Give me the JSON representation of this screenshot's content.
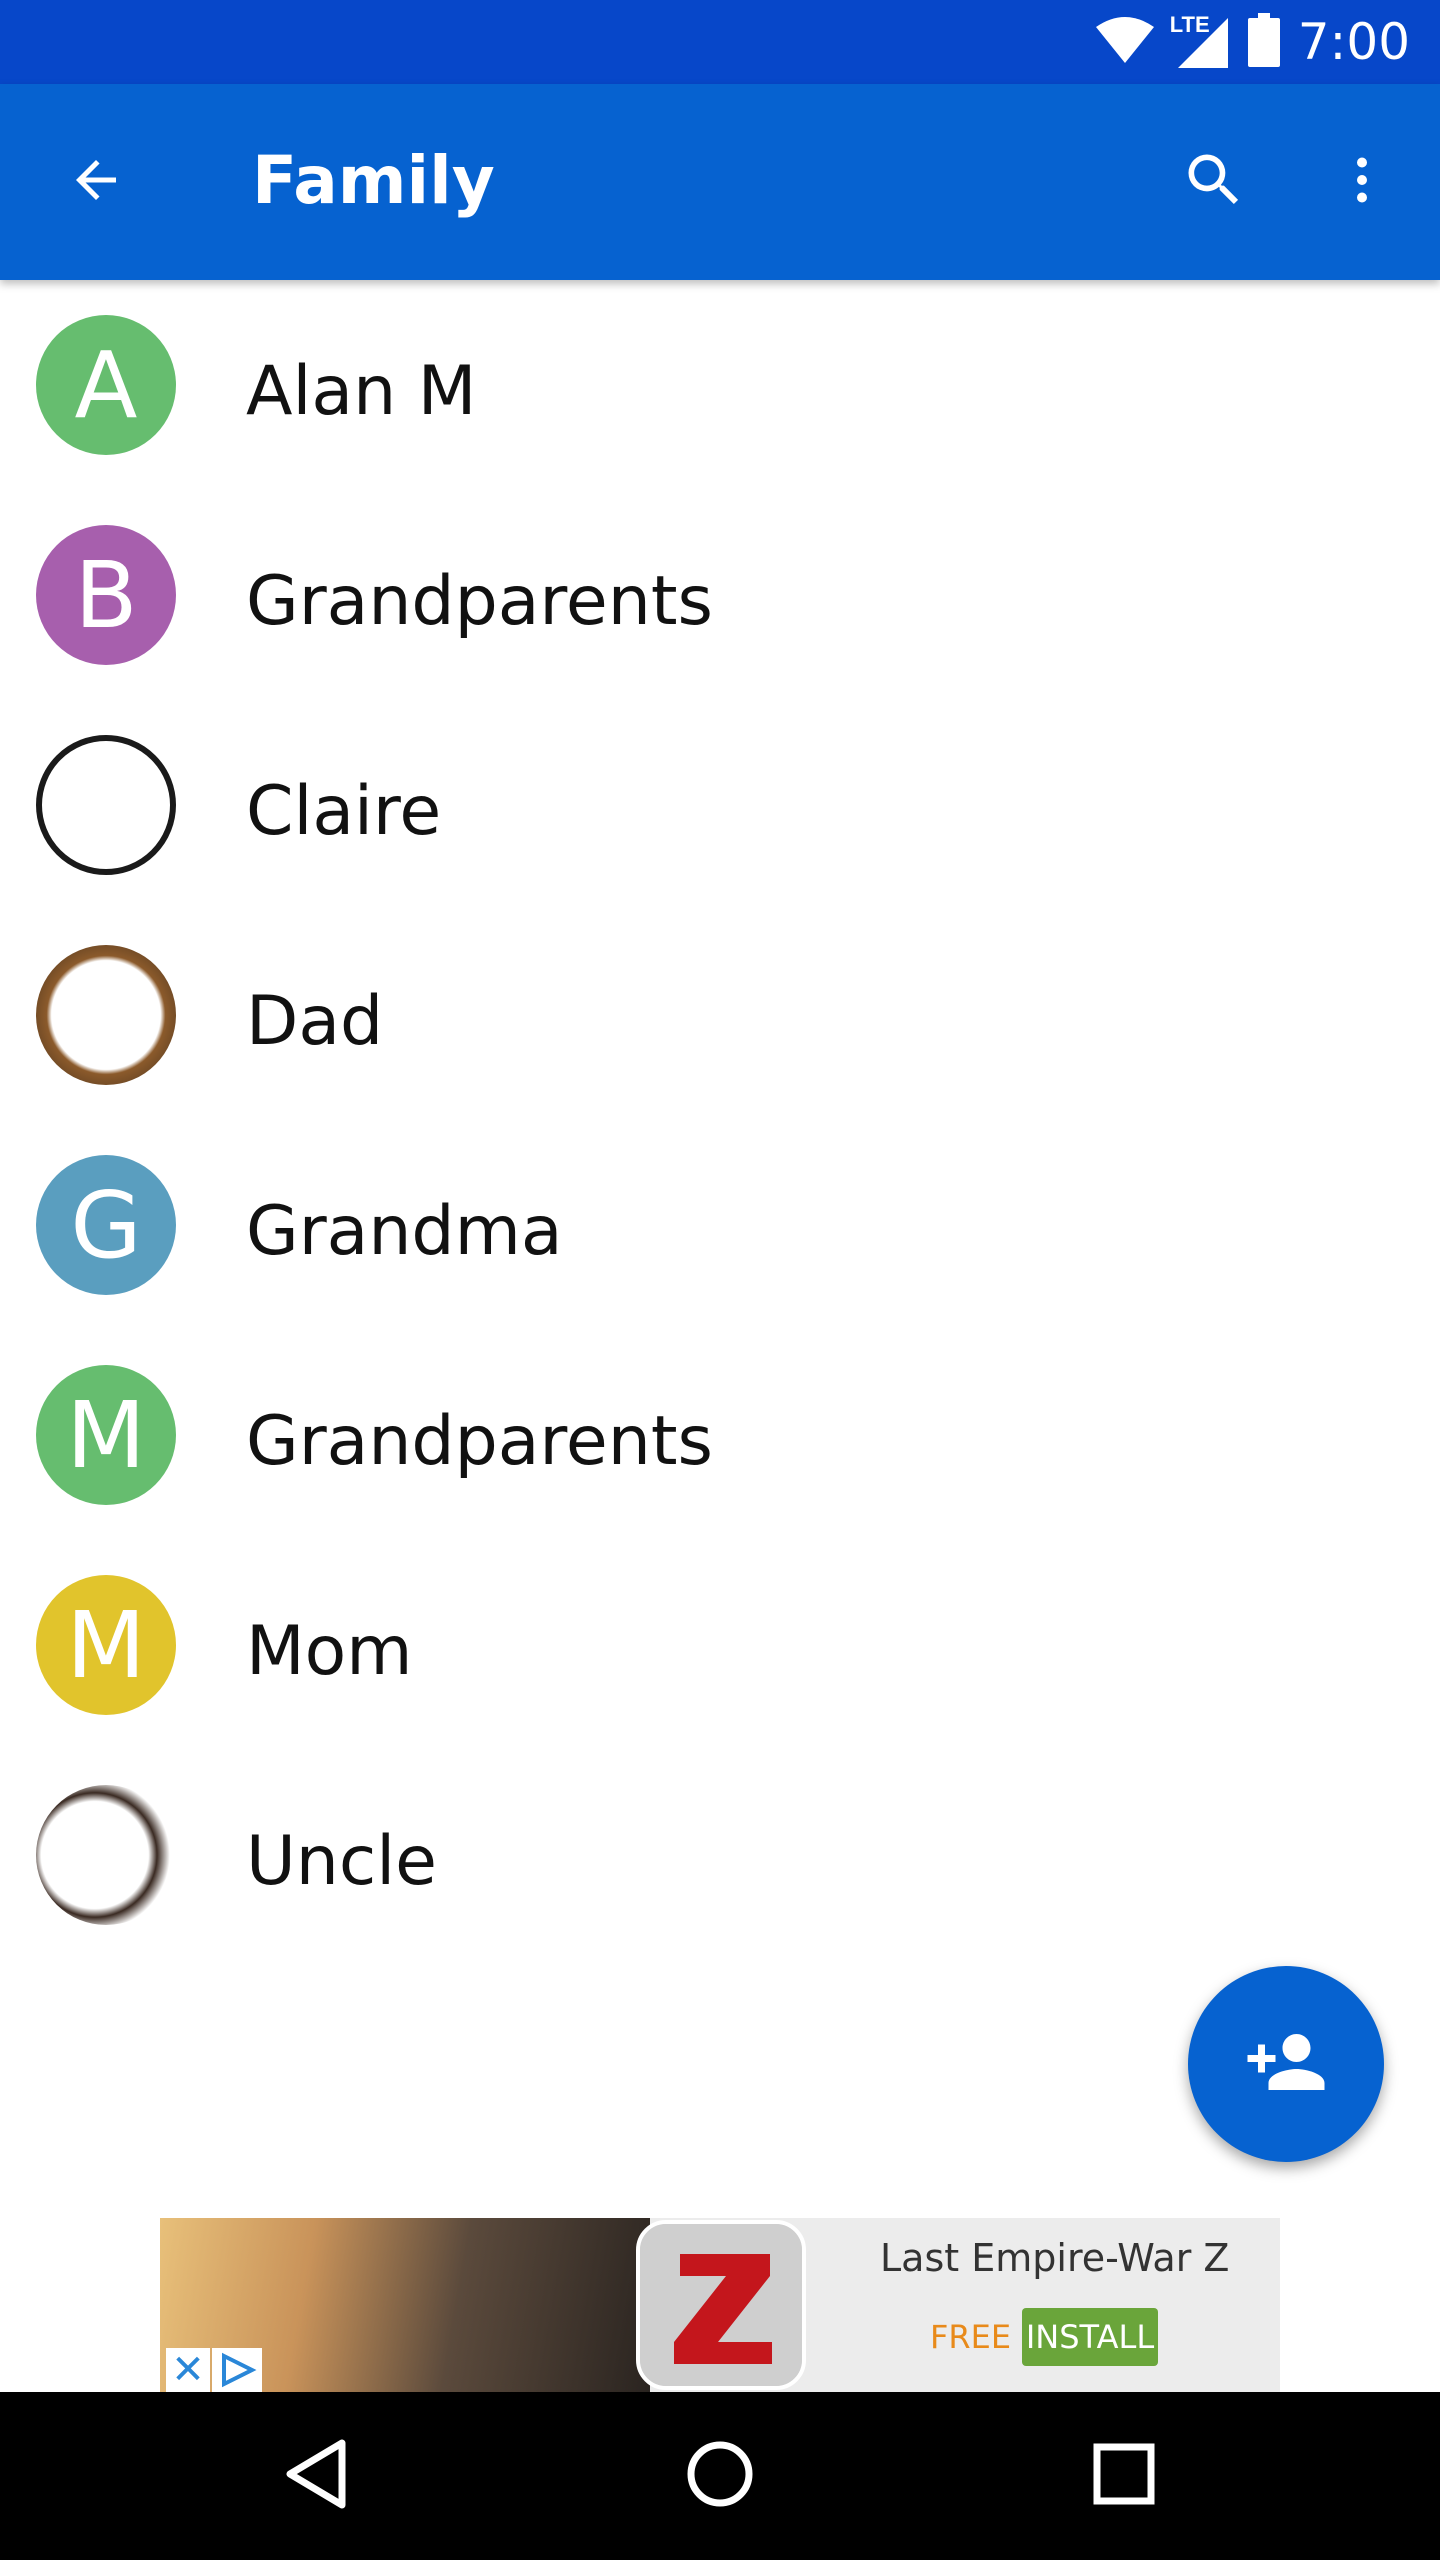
{
  "status_bar": {
    "time": "7:00",
    "network_label": "LTE",
    "icons": [
      "wifi-icon",
      "cellular-signal-icon",
      "battery-icon"
    ]
  },
  "app_bar": {
    "title": "Family",
    "icons": [
      "back-arrow-icon",
      "search-icon",
      "more-vert-icon"
    ]
  },
  "contacts": [
    {
      "name": "Alan M",
      "initial": "A",
      "color": "#66bd6f",
      "photo": false
    },
    {
      "name": "Grandparents",
      "initial": "B",
      "color": "#a75fad",
      "photo": false
    },
    {
      "name": "Claire",
      "initial": "",
      "color": "#ffffff",
      "photo": true
    },
    {
      "name": "Dad",
      "initial": "",
      "color": "#ffffff",
      "photo": true
    },
    {
      "name": "Grandma",
      "initial": "G",
      "color": "#5a9ebf",
      "photo": false
    },
    {
      "name": "Grandparents",
      "initial": "M",
      "color": "#66bd6f",
      "photo": false
    },
    {
      "name": "Mom",
      "initial": "M",
      "color": "#e1c42c",
      "photo": false
    },
    {
      "name": "Uncle",
      "initial": "",
      "color": "#ffffff",
      "photo": true
    }
  ],
  "fab": {
    "icon": "add-person-icon"
  },
  "ad": {
    "title": "Last Empire-War Z",
    "price": "FREE",
    "install_label": "INSTALL",
    "icons": [
      "close-icon",
      "ad-choices-icon"
    ]
  },
  "nav_bar": {
    "icons": [
      "nav-back-icon",
      "nav-home-icon",
      "nav-recents-icon"
    ]
  },
  "colors": {
    "status_bar": "#0747c9",
    "app_bar": "#0662d0",
    "fab": "#0662d0",
    "install_button": "#6aa53a",
    "free_text": "#e88a1a"
  }
}
